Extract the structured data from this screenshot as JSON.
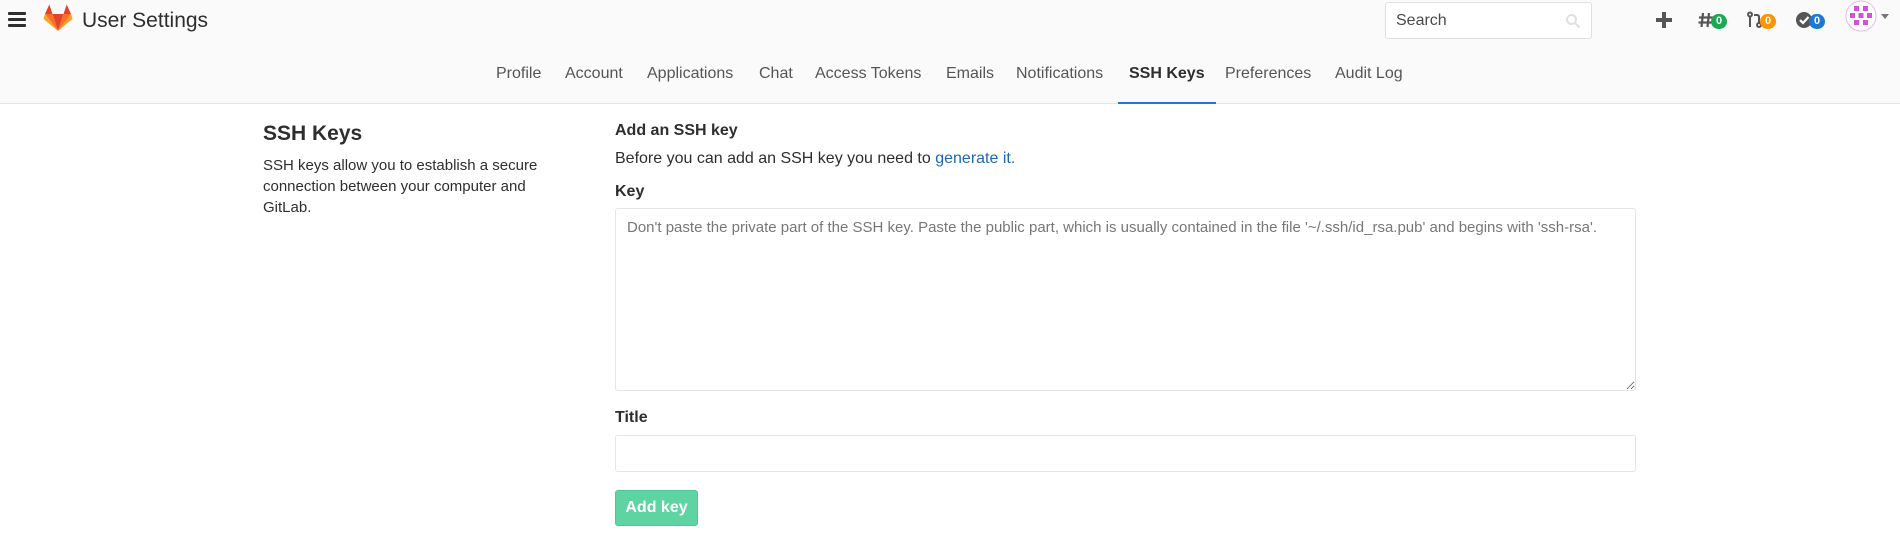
{
  "header": {
    "title": "User Settings",
    "menu_icon": "hamburger-icon",
    "logo_icon": "gitlab-logo",
    "search_placeholder": "Search",
    "icons": {
      "new": "plus-icon",
      "issues": {
        "icon": "issues-icon",
        "count": "0",
        "color": "#1aaa55"
      },
      "merge_requests": {
        "icon": "merge-request-icon",
        "count": "0",
        "color": "#fc9403"
      },
      "todos": {
        "icon": "todo-icon",
        "count": "0",
        "color": "#1f78d1"
      },
      "user": "avatar-icon"
    }
  },
  "tabs": [
    {
      "label": "Profile"
    },
    {
      "label": "Account"
    },
    {
      "label": "Applications"
    },
    {
      "label": "Chat"
    },
    {
      "label": "Access Tokens"
    },
    {
      "label": "Emails"
    },
    {
      "label": "Notifications"
    },
    {
      "label": "SSH Keys",
      "active": true
    },
    {
      "label": "Preferences"
    },
    {
      "label": "Audit Log"
    }
  ],
  "left": {
    "title": "SSH Keys",
    "description": "SSH keys allow you to establish a secure connection between your computer and GitLab."
  },
  "form": {
    "heading": "Add an SSH key",
    "intro_text": "Before you can add an SSH key you need to ",
    "intro_link": "generate it.",
    "key_label": "Key",
    "key_placeholder": "Don't paste the private part of the SSH key. Paste the public part, which is usually contained in the file '~/.ssh/id_rsa.pub' and begins with 'ssh-rsa'.",
    "title_label": "Title",
    "title_value": "",
    "submit_label": "Add key"
  },
  "colors": {
    "accent": "#1f78d1",
    "link": "#1b69b6",
    "button": "#5dd4a2"
  }
}
